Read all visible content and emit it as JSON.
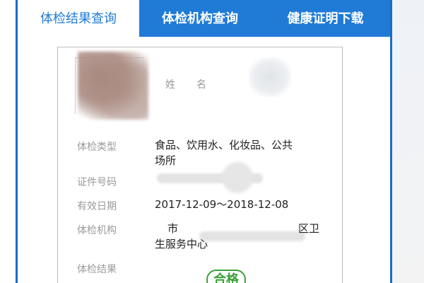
{
  "tabs": [
    {
      "label": "体检结果查询",
      "active": true
    },
    {
      "label": "体检机构查询",
      "active": false
    },
    {
      "label": "健康证明下载",
      "active": false
    }
  ],
  "certificate": {
    "name_label": "姓名",
    "exam_type_label": "体检类型",
    "exam_type_value_line1": "食品、饮用水、化妆品、公共",
    "exam_type_value_line2": "场所",
    "id_number_label": "证件号码",
    "validity_label": "有效日期",
    "validity_value": "2017-12-09～2018-12-08",
    "org_label": "体检机构",
    "org_value_line1": "市",
    "org_value_line1_end": "区卫",
    "org_value_line2": "生服务中心",
    "result_label": "体检结果",
    "result_stamp": "合格"
  },
  "colors": {
    "tab_bar": "#1f7bd6",
    "stamp": "#3aa03a",
    "label_gray": "#9a9a9a"
  }
}
